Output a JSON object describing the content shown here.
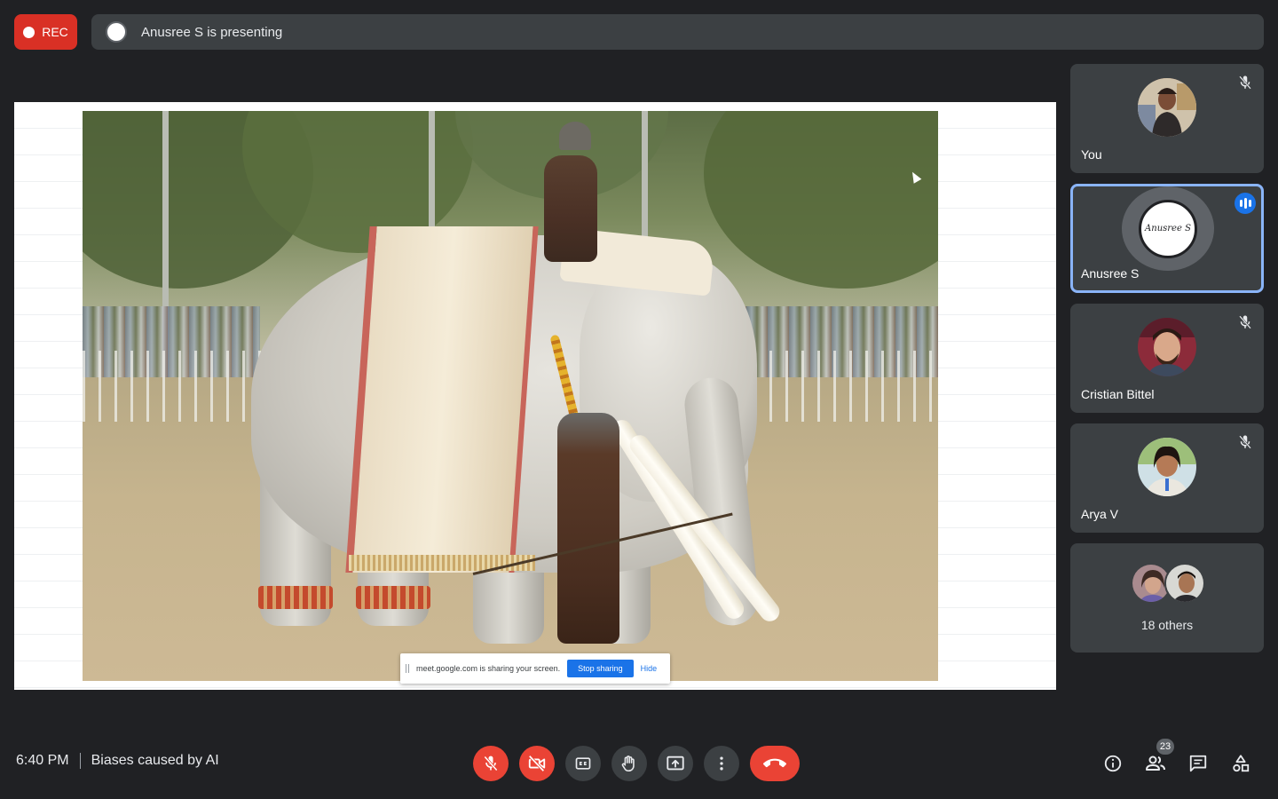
{
  "recording": {
    "label": "REC",
    "color": "#d93025"
  },
  "presenting_banner": {
    "text": "Anusree S is presenting"
  },
  "shared_screen": {
    "share_notice": "meet.google.com is sharing your screen.",
    "stop_sharing": "Stop sharing",
    "hide": "Hide"
  },
  "participants": [
    {
      "name": "You",
      "muted": true,
      "icon": "mic-off-icon"
    },
    {
      "name": "Anusree S",
      "speaking": true,
      "avatar_text": "Anusree S",
      "icon": "speaking-indicator-icon"
    },
    {
      "name": "Cristian Bittel",
      "muted": true,
      "icon": "mic-off-icon"
    },
    {
      "name": "Arya V",
      "muted": true,
      "icon": "mic-off-icon"
    }
  ],
  "others": {
    "label": "18 others"
  },
  "footer": {
    "time": "6:40 PM",
    "meeting_title": "Biases caused by AI",
    "people_count": "23"
  },
  "controls": [
    {
      "name": "microphone-off",
      "icon": "mic-off-icon",
      "state": "off"
    },
    {
      "name": "camera-off",
      "icon": "video-off-icon",
      "state": "off"
    },
    {
      "name": "captions",
      "icon": "cc-icon"
    },
    {
      "name": "raise-hand",
      "icon": "hand-icon"
    },
    {
      "name": "present-now",
      "icon": "present-screen-icon"
    },
    {
      "name": "more-options",
      "icon": "more-vert-icon"
    },
    {
      "name": "leave-call",
      "icon": "call-end-icon"
    }
  ],
  "side_controls": [
    {
      "name": "meeting-details",
      "icon": "info-icon"
    },
    {
      "name": "people",
      "icon": "people-icon"
    },
    {
      "name": "chat",
      "icon": "chat-icon"
    },
    {
      "name": "activities",
      "icon": "shapes-icon"
    }
  ],
  "colors": {
    "accent": "#8ab4f8",
    "danger": "#ea4335",
    "surface": "#3c4043",
    "background": "#202124"
  }
}
